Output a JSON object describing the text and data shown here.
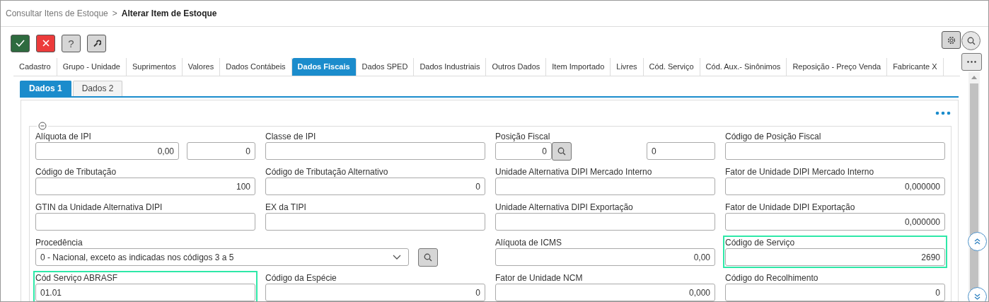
{
  "breadcrumb": {
    "parent": "Consultar Itens de Estoque",
    "separator": ">",
    "current": "Alterar Item de Estoque"
  },
  "toolbar": [
    {
      "kind": "confirm"
    },
    {
      "kind": "cancel"
    },
    {
      "kind": "help",
      "label": "?"
    },
    {
      "kind": "tools"
    }
  ],
  "tabs": [
    {
      "label": "Cadastro",
      "selected": false
    },
    {
      "label": "Grupo - Unidade",
      "selected": false
    },
    {
      "label": "Suprimentos",
      "selected": false
    },
    {
      "label": "Valores",
      "selected": false
    },
    {
      "label": "Dados Contábeis",
      "selected": false
    },
    {
      "label": "Dados Fiscais",
      "selected": true
    },
    {
      "label": "Dados SPED",
      "selected": false
    },
    {
      "label": "Dados Industriais",
      "selected": false
    },
    {
      "label": "Outros Dados",
      "selected": false
    },
    {
      "label": "Item Importado",
      "selected": false
    },
    {
      "label": "Livres",
      "selected": false
    },
    {
      "label": "Cód. Serviço",
      "selected": false
    },
    {
      "label": "Cód. Aux.- Sinônimos",
      "selected": false
    },
    {
      "label": "Reposição - Preço Venda",
      "selected": false
    },
    {
      "label": "Fabricante X",
      "selected": false
    }
  ],
  "subtabs": [
    {
      "label": "Dados 1",
      "selected": true
    },
    {
      "label": "Dados 2",
      "selected": false
    }
  ],
  "section": {
    "expanded": true,
    "fields": [
      {
        "label": "Alíquota de IPI",
        "kind": "pair",
        "highlighted": false,
        "inputs": [
          {
            "numeric": true,
            "value": "0,00"
          },
          {
            "numeric": true,
            "value": "0"
          }
        ]
      },
      {
        "label": "Classe de IPI",
        "kind": "input",
        "highlighted": false
      },
      {
        "label": "Posição Fiscal",
        "kind": "lookup",
        "highlighted": false,
        "inputs": [
          {
            "numeric": true,
            "value": "0"
          },
          {
            "numeric": false,
            "value": "0"
          }
        ]
      },
      {
        "label": "Código de Posição Fiscal",
        "kind": "input",
        "highlighted": false
      },
      {
        "label": "Código de Tributação",
        "kind": "input",
        "highlighted": false,
        "inputs": [
          {
            "numeric": true,
            "value": "100"
          }
        ]
      },
      {
        "label": "Código de Tributação Alternativo",
        "kind": "input",
        "highlighted": false,
        "inputs": [
          {
            "numeric": true,
            "value": "0"
          }
        ]
      },
      {
        "label": "Unidade Alternativa DIPI Mercado Interno",
        "kind": "input",
        "highlighted": false
      },
      {
        "label": "Fator de Unidade DIPI Mercado Interno",
        "kind": "input",
        "highlighted": false,
        "inputs": [
          {
            "numeric": true,
            "value": "0,000000"
          }
        ]
      },
      {
        "label": "GTIN da Unidade Alternativa DIPI",
        "kind": "input",
        "highlighted": false
      },
      {
        "label": "EX da TIPI",
        "kind": "input",
        "highlighted": false
      },
      {
        "label": "Unidade Alternativa DIPI Exportação",
        "kind": "input",
        "highlighted": false
      },
      {
        "label": "Fator de Unidade DIPI Exportação",
        "kind": "input",
        "highlighted": false,
        "inputs": [
          {
            "numeric": true,
            "value": "0,000000"
          }
        ]
      },
      {
        "label": "Procedência",
        "kind": "select",
        "highlighted": false,
        "inputs": [
          {
            "value": "0 - Nacional, exceto as indicadas nos códigos 3 a 5"
          }
        ]
      },
      {
        "label": "Alíquota de ICMS",
        "kind": "input",
        "highlighted": false,
        "inputs": [
          {
            "numeric": true,
            "value": "0,00"
          }
        ]
      },
      {
        "label": "Código de Serviço",
        "kind": "input",
        "highlighted": true,
        "inputs": [
          {
            "numeric": true,
            "value": "2690"
          }
        ]
      },
      {
        "label": "Cód Serviço ABRASF",
        "kind": "input",
        "highlighted": true,
        "inputs": [
          {
            "numeric": false,
            "value": "01.01"
          }
        ]
      },
      {
        "label": "Código da Espécie",
        "kind": "input",
        "highlighted": false,
        "inputs": [
          {
            "numeric": true,
            "value": "0"
          }
        ]
      },
      {
        "label": "Fator de Unidade NCM",
        "kind": "input",
        "highlighted": false,
        "inputs": [
          {
            "numeric": true,
            "value": "0,000"
          }
        ]
      },
      {
        "label": "Código do Recolhimento",
        "kind": "input",
        "highlighted": false,
        "inputs": [
          {
            "numeric": true,
            "value": "0"
          }
        ]
      }
    ]
  }
}
